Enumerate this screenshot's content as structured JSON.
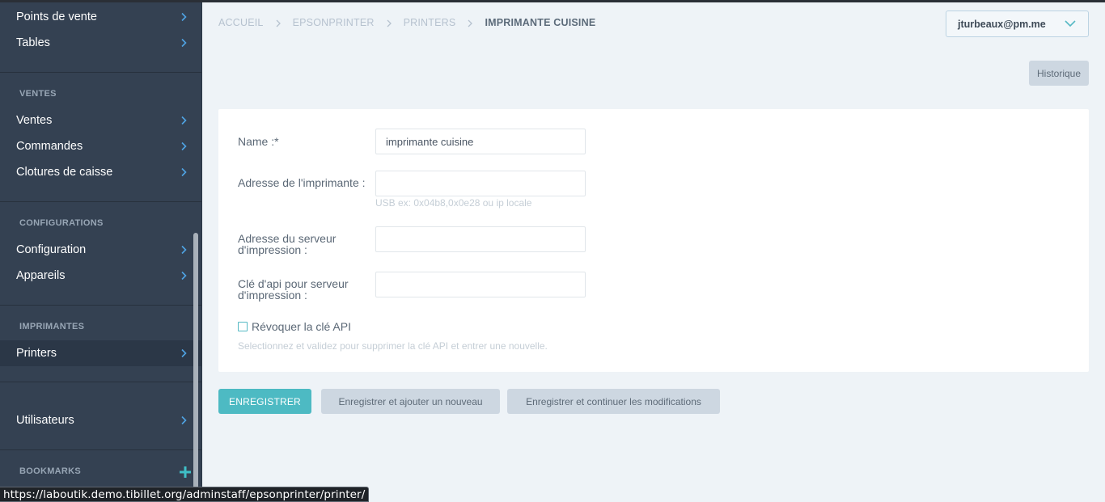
{
  "sidebar": {
    "items_top": [
      {
        "label": "Points de vente"
      },
      {
        "label": "Tables"
      }
    ],
    "sections": [
      {
        "title": "VENTES",
        "items": [
          {
            "label": "Ventes"
          },
          {
            "label": "Commandes"
          },
          {
            "label": "Clotures de caisse"
          }
        ]
      },
      {
        "title": "CONFIGURATIONS",
        "items": [
          {
            "label": "Configuration"
          },
          {
            "label": "Appareils"
          }
        ]
      },
      {
        "title": "IMPRIMANTES",
        "items": [
          {
            "label": "Printers"
          }
        ]
      }
    ],
    "users_item": {
      "label": "Utilisateurs"
    },
    "bookmarks_title": "BOOKMARKS"
  },
  "breadcrumb": [
    "ACCUEIL",
    "EPSONPRINTER",
    "PRINTERS",
    "IMPRIMANTE CUISINE"
  ],
  "user": {
    "email": "jturbeaux@pm.me"
  },
  "history_button": "Historique",
  "form": {
    "name": {
      "label": "Name :*",
      "value": "imprimante cuisine"
    },
    "address": {
      "label": "Adresse de l'imprimante :",
      "value": "",
      "help": "USB ex: 0x04b8,0x0e28 ou ip locale"
    },
    "server": {
      "label_line1": "Adresse du serveur",
      "label_line2": "d'impression :",
      "value": ""
    },
    "api_key": {
      "label_line1": "Clé d'api pour serveur",
      "label_line2": "d'impression :",
      "value": ""
    },
    "revoke": {
      "label": "Révoquer la clé API",
      "checked": false,
      "help": "Selectionnez et validez pour supprimer la clé API et entrer une nouvelle."
    }
  },
  "actions": {
    "save": "ENREGISTRER",
    "save_add": "Enregistrer et ajouter un nouveau",
    "save_continue": "Enregistrer et continuer les modifications"
  },
  "status_url": "https://laboutik.demo.tibillet.org/adminstaff/epsonprinter/printer/",
  "colors": {
    "sidebar_bg": "#344152",
    "accent": "#4dbac3",
    "page_bg": "#eef3f7"
  }
}
